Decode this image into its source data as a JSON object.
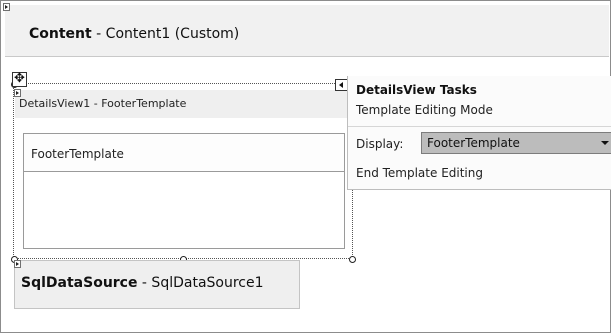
{
  "content_panel": {
    "title_bold": "Content",
    "title_rest": " - Content1 (Custom)"
  },
  "details_view": {
    "header_label": "DetailsView1 - FooterTemplate",
    "template_title": "FooterTemplate"
  },
  "tasks_panel": {
    "title": "DetailsView Tasks",
    "subtitle": "Template Editing Mode",
    "display_label": "Display:",
    "display_value": "FooterTemplate",
    "end_link": "End Template Editing"
  },
  "sql_data_source": {
    "label_bold": "SqlDataSource",
    "label_rest": " - SqlDataSource1"
  },
  "icons": {
    "move": "move-icon",
    "smart_tag": "smart-tag-icon",
    "expand": "expand-glyph-icon",
    "dropdown": "chevron-down-icon"
  }
}
